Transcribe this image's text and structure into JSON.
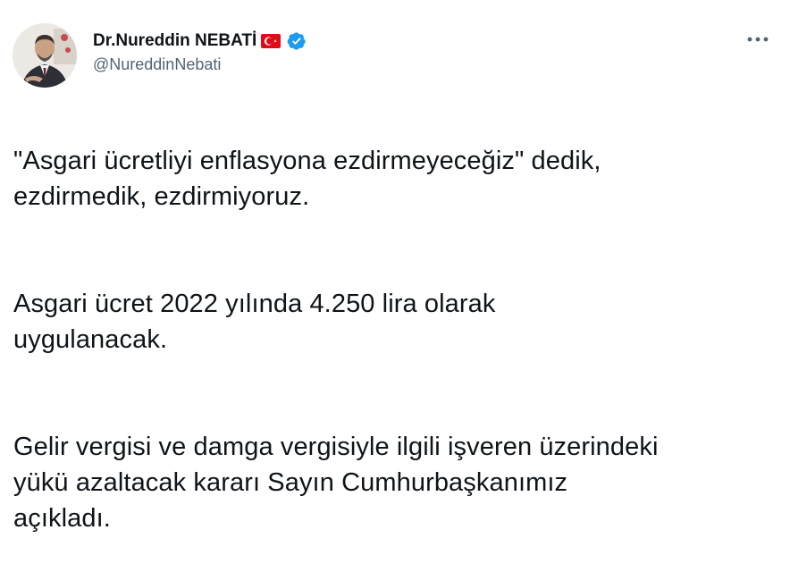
{
  "user": {
    "display_name": "Dr.Nureddin NEBATİ",
    "handle": "@NureddinNebati",
    "flag_icon": "turkey-flag-icon",
    "verified_icon": "verified-badge-icon",
    "verified_color": "#1d9bf0"
  },
  "menu": {
    "more_icon": "more-horizontal-icon"
  },
  "tweet": {
    "paragraphs": [
      "\"Asgari ücretliyi enflasyona ezdirmeyeceğiz\" dedik,\nezdirmedik, ezdirmiyoruz.",
      "Asgari ücret 2022 yılında 4.250 lira olarak\nuygulanacak.",
      "Gelir vergisi ve damga vergisiyle ilgili işveren üzerindeki\nyükü azaltacak kararı Sayın Cumhurbaşkanımız\naçıkladı."
    ]
  },
  "colors": {
    "text": "#0f1419",
    "secondary": "#536471",
    "flag_red": "#e30a17"
  }
}
